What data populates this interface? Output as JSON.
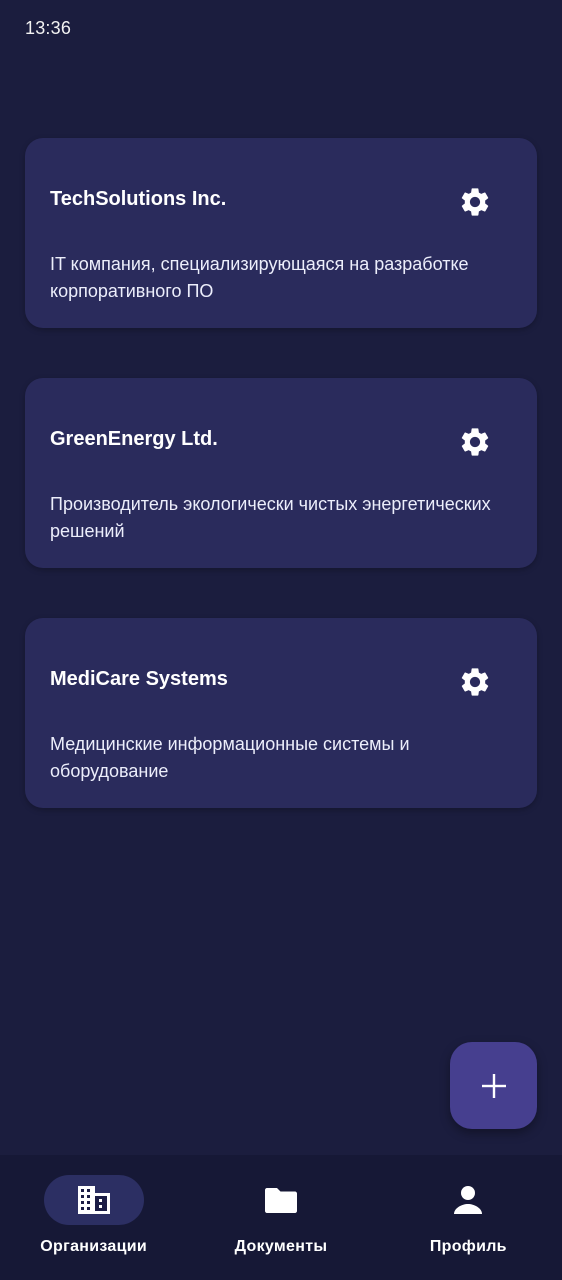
{
  "status_bar": {
    "time": "13:36"
  },
  "organizations": [
    {
      "name": "TechSolutions Inc.",
      "description": "IT компания, специализирующаяся на разработке корпоративного ПО"
    },
    {
      "name": "GreenEnergy Ltd.",
      "description": "Производитель экологически чистых энергетических решений"
    },
    {
      "name": "MediCare Systems",
      "description": "Медицинские информационные системы и оборудование"
    }
  ],
  "fab": {
    "icon": "plus-icon"
  },
  "bottom_nav": {
    "items": [
      {
        "label": "Организации",
        "icon": "building-icon",
        "active": true
      },
      {
        "label": "Документы",
        "icon": "folder-icon",
        "active": false
      },
      {
        "label": "Профиль",
        "icon": "person-icon",
        "active": false
      }
    ]
  },
  "colors": {
    "background": "#1b1d3e",
    "card": "#2a2b5c",
    "fab": "#463f8f",
    "nav_background": "#161836",
    "nav_active_pill": "#2c2f63"
  }
}
